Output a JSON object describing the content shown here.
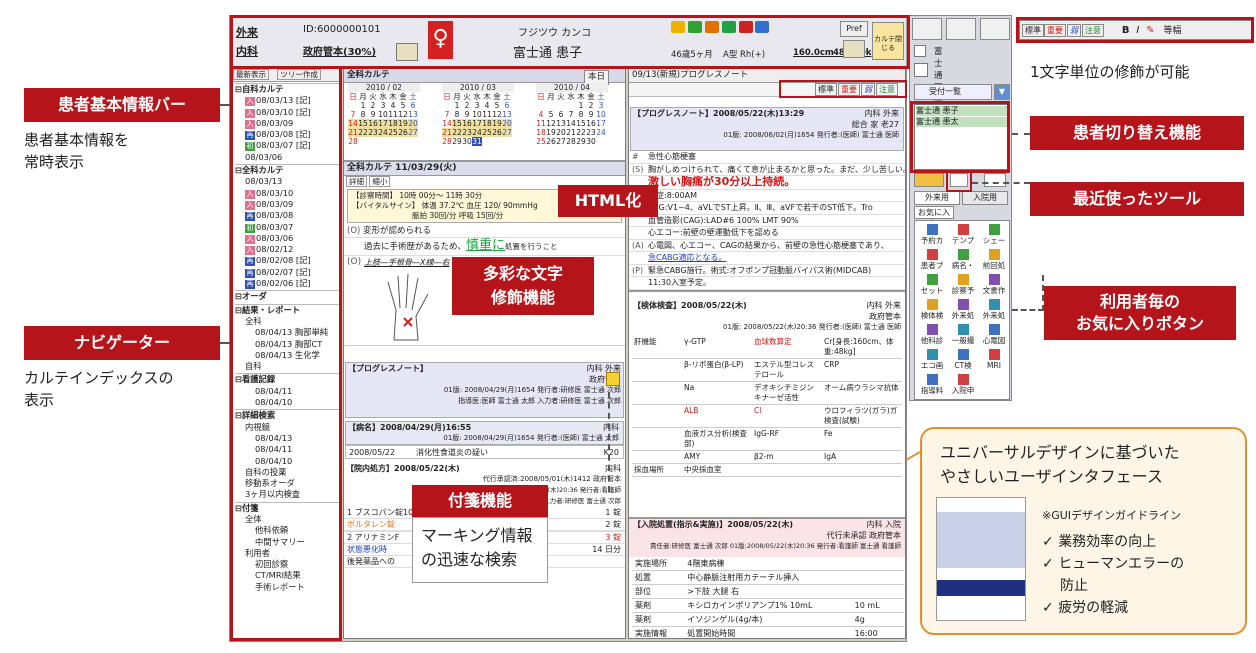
{
  "labels": {
    "patient_bar": "患者基本情報バー",
    "patient_bar_desc1": "患者基本情報を",
    "patient_bar_desc2": "常時表示",
    "navigator": "ナビゲーター",
    "navigator_desc1": "カルテインデックスの",
    "navigator_desc2": "表示",
    "html": "HTML化",
    "text_deco1": "多彩な文字",
    "text_deco2": "修飾機能",
    "sticky": "付箋機能",
    "sticky_desc1": "マーキング情報",
    "sticky_desc2": "の迅速な検索",
    "char_unit": "1文字単位の修飾が可能",
    "patient_switch": "患者切り替え機能",
    "recent_tool": "最近使ったツール",
    "favorites1": "利用者毎の",
    "favorites2": "お気に入りボタン",
    "ud_title1": "ユニバーサルデザインに基づいた",
    "ud_title2": "やさしいユーザインタフェース",
    "ud_guide": "※GUIデザインガイドライン",
    "ud_points": [
      "業務効率の向上",
      "ヒューマンエラーの",
      "防止",
      "疲労の軽減"
    ]
  },
  "patient": {
    "dept": "外来",
    "ward": "内科",
    "id": "ID:6000000101",
    "doctor": "政府管本(30%)",
    "kana": "フジツウ カンコ",
    "name": "富士通 患子",
    "age": "46歳5ヶ月",
    "blood": "A型 Rh(+)",
    "height": "160.0cm",
    "weight": "48.000kg",
    "pref": "Pref",
    "close": "カルテ閉じる"
  },
  "toolbar_right": {
    "deco": [
      "標準",
      "重要",
      "弱",
      "注意",
      "B",
      "I",
      "等幅"
    ],
    "user": "富士通 医師",
    "reception": "受付一覧"
  },
  "nav": {
    "btn1": "最新表示",
    "btn2": "ツリー作成",
    "items": [
      {
        "t": "自科カルテ",
        "c": "hd"
      },
      {
        "t": "08/03/13 [記]",
        "c": "in1",
        "m": "入",
        "mc": "#e07090"
      },
      {
        "t": "08/03/10 [記]",
        "c": "in1",
        "m": "入",
        "mc": "#e07090"
      },
      {
        "t": "08/03/09",
        "c": "in1",
        "m": "入",
        "mc": "#e07090"
      },
      {
        "t": "08/03/08 [記]",
        "c": "in1",
        "m": "再",
        "mc": "#3050b0"
      },
      {
        "t": "08/03/07 [記]",
        "c": "in1",
        "m": "初",
        "mc": "#40a040"
      },
      {
        "t": "08/03/06",
        "c": "in1",
        "m": "",
        "mc": ""
      },
      {
        "t": "全科カルテ",
        "c": "hd"
      },
      {
        "t": "08/03/13",
        "c": "in1",
        "m": "",
        "mc": ""
      },
      {
        "t": "08/03/10",
        "c": "in1",
        "m": "入",
        "mc": "#e07090"
      },
      {
        "t": "08/03/09",
        "c": "in1",
        "m": "入",
        "mc": "#e07090"
      },
      {
        "t": "08/03/08",
        "c": "in1",
        "m": "再",
        "mc": "#3050b0"
      },
      {
        "t": "08/03/07",
        "c": "in1",
        "m": "初",
        "mc": "#40a040"
      },
      {
        "t": "08/03/06",
        "c": "in1",
        "m": "入",
        "mc": "#e07090"
      },
      {
        "t": "08/02/12",
        "c": "in1",
        "m": "入",
        "mc": "#e07090"
      },
      {
        "t": "08/02/08 [記]",
        "c": "in1",
        "m": "再",
        "mc": "#3050b0"
      },
      {
        "t": "08/02/07 [記]",
        "c": "in1",
        "m": "再",
        "mc": "#3050b0"
      },
      {
        "t": "08/02/06 [記]",
        "c": "in1",
        "m": "再",
        "mc": "#3050b0"
      },
      {
        "t": "オーダ",
        "c": "hd"
      },
      {
        "t": "結果・レポート",
        "c": "hd"
      },
      {
        "t": "全科",
        "c": "in1",
        "m": "",
        "mc": ""
      },
      {
        "t": "08/04/13 胸部単純",
        "c": "in2",
        "m": "",
        "mc": ""
      },
      {
        "t": "08/04/13 胸部CT",
        "c": "in2",
        "m": "",
        "mc": ""
      },
      {
        "t": "08/04/13 生化学",
        "c": "in2",
        "m": "",
        "mc": ""
      },
      {
        "t": "自科",
        "c": "in1",
        "m": "",
        "mc": ""
      },
      {
        "t": "看護記録",
        "c": "hd"
      },
      {
        "t": "08/04/11",
        "c": "in2",
        "m": "",
        "mc": ""
      },
      {
        "t": "08/04/10",
        "c": "in2",
        "m": "",
        "mc": ""
      },
      {
        "t": "詳細検索",
        "c": "hd"
      },
      {
        "t": "内視鏡",
        "c": "in1",
        "m": "",
        "mc": ""
      },
      {
        "t": "08/04/13",
        "c": "in2",
        "m": "",
        "mc": ""
      },
      {
        "t": "08/04/11",
        "c": "in2",
        "m": "",
        "mc": ""
      },
      {
        "t": "08/04/10",
        "c": "in2",
        "m": "",
        "mc": ""
      },
      {
        "t": "自科の投薬",
        "c": "in1",
        "m": "",
        "mc": ""
      },
      {
        "t": "移動系オーダ",
        "c": "in1",
        "m": "",
        "mc": ""
      },
      {
        "t": "3ヶ月以内検査",
        "c": "in1",
        "m": "",
        "mc": ""
      },
      {
        "t": "付箋",
        "c": "hd"
      },
      {
        "t": "全体",
        "c": "in1",
        "m": "",
        "mc": ""
      },
      {
        "t": "他科依頼",
        "c": "in2",
        "m": "",
        "mc": ""
      },
      {
        "t": "中間サマリー",
        "c": "in2",
        "m": "",
        "mc": ""
      },
      {
        "t": "利用者",
        "c": "in1",
        "m": "",
        "mc": ""
      },
      {
        "t": "初回診察",
        "c": "in2",
        "m": "",
        "mc": ""
      },
      {
        "t": "CT/MRI結果",
        "c": "in2",
        "m": "",
        "mc": ""
      },
      {
        "t": "手術レポート",
        "c": "in2",
        "m": "",
        "mc": ""
      }
    ]
  },
  "karte": {
    "title": "全科カルテ",
    "today": "本日",
    "months": [
      "2010 / 02",
      "2010 / 03",
      "2010 / 04"
    ],
    "dow": [
      "日",
      "月",
      "火",
      "水",
      "木",
      "金",
      "土"
    ],
    "entry_title": "全科カルテ 11/03/29(火)",
    "detail": "詳細",
    "shrink": "縮小",
    "vitals1": "【診察時間】 10時 00分～ 11時 30分",
    "vitals2": "【バイタルサイン】 体温 37.2℃  血圧 120/ 90mmHg",
    "vitals3": "脈拍 30回/分  呼吸 15回/分",
    "o1": "変形が認められる",
    "o2a": "過去に手術歴があるため、",
    "o2b": "慎重に",
    "o2c": "処置を行うこと",
    "o3": "上肢―手根骨―X線―右",
    "prog_title": "【プログレスノート】",
    "prog_dept": "内科 外来",
    "prog_doc": "政府管本",
    "prog_ver": "01版: 2008/04/29(月)1654 発行者:研修医 富士通 次郎",
    "prog_ver2": "指導医:医師 富士通 太郎 入力者:研修医 富士通 次郎",
    "disease_h": "【病名】2008/04/29(月)16:55",
    "disease_dept": "内科",
    "disease_ver": "01版: 2008/04/29(月)1654 発行者:(医師) 富士通 太郎",
    "disease_row": [
      "2008/05/22",
      "消化性食道炎の疑い",
      "K20"
    ],
    "rx_h": "【院内処方】2008/05/22(木)",
    "rx_dept": "内科",
    "rx_l1": "代行承認済:2008/05/01(木)1412 政府管本",
    "rx_l2": "責任者:研修医 富士通 次郎 01版:2008/05/22(木)20:36 発行者:看護師",
    "rx_l3": "指導医:医師 富士通 太郎 入力者:研修医 富士通 次郎",
    "rx_items": [
      [
        "1 ブスコパン錠10mg",
        "1 錠"
      ],
      [
        "ボルタレン錠",
        "2 錠"
      ],
      [
        "",
        "2 日分"
      ],
      [
        "2 アリナミンF",
        "3 錠"
      ],
      [
        "状態悪化時",
        "14 日分"
      ],
      [
        "後発薬品への",
        ""
      ]
    ]
  },
  "progress": {
    "title": "09/13(新規)プログレスノート",
    "deco": [
      "標準",
      "重要",
      "弱",
      "注意"
    ],
    "h": "【プログレスノート】2008/05/22(木)13:29",
    "dept": "内科 外来",
    "l1": "総合 家 老27",
    "l2": "01版: 2008/06/02(月)1654 発行者:(医師) 富士通 医師",
    "rows": [
      {
        "k": "#",
        "t": "急性心筋梗塞",
        "c": ""
      },
      {
        "k": "(S)",
        "t": "胸がしめつけられて、痛くて息が止まるかと思った。まだ、少し苦しい。",
        "c": ""
      },
      {
        "k": "",
        "t": "激しい胸痛が30分以上持続。",
        "c": "red"
      },
      {
        "k": "(O)",
        "t": "発症:8:00AM",
        "c": ""
      },
      {
        "k": "",
        "t": "ECG:V1~4、aVLでST上昇。Ⅱ、Ⅲ、aVFで若干のST低下。Tro",
        "c": ""
      },
      {
        "k": "",
        "t": "血管造影(CAG):LAD#6 100% LMT 90%",
        "c": ""
      },
      {
        "k": "",
        "t": "心エコー:前壁の壁運動低下を認める",
        "c": ""
      },
      {
        "k": "(A)",
        "t": "心電図、心エコー、CAGの結果から、前壁の急性心筋梗塞であり、",
        "c": ""
      },
      {
        "k": "",
        "t": "急CABG適応となる。",
        "c": "blue"
      },
      {
        "k": "(P)",
        "t": "緊急CABG施行。術式:オフポンプ冠動脈バイパス術(MIDCAB)",
        "c": ""
      },
      {
        "k": "",
        "t": "11:30入室予定。",
        "c": ""
      }
    ],
    "lab_h": "【検体検査】2008/05/22(木)",
    "lab_dept": "内科 外来",
    "lab_doc": "政府管本",
    "lab_ver": "01版: 2008/05/22(木)20:36 発行者:(医師) 富士通 医師",
    "lab_rows": [
      [
        "肝機能",
        "γ-GTP",
        "血球数算定",
        "Cr[身長:160cm、体重:48kg]"
      ],
      [
        "",
        "β-リポ蛋白(β-LP)",
        "エステル型コレステロール",
        "CRP"
      ],
      [
        "",
        "Na",
        "デオキシチミジンキナーゼ活性",
        "オーム病ウラシマ抗体"
      ],
      [
        "",
        "ALB",
        "Cl",
        "ウロフィラツ(ガラ)ガ 検査(試験)"
      ],
      [
        "",
        "血液ガス分析(検査部)",
        "IgG-RF",
        "Fe"
      ],
      [
        "",
        "AMY",
        "β2-m",
        "IgA"
      ],
      [
        "採血場所",
        "中央採血室",
        "",
        ""
      ]
    ],
    "inj_h": "【入院処置(指示&実施)】2008/05/22(木)",
    "inj_dept": "内科 入院",
    "inj_l1": "代行未承認 政府管本",
    "inj_l2": "責任者:研修医 富士通 次郎 01版:2008/05/22(木)20:36 発行者:看護師 富士通 看護師",
    "inj_rows": [
      [
        "実施場所",
        "4階東病棟",
        ""
      ],
      [
        "処置",
        "中心静脈注射用カテーテル挿入",
        ""
      ],
      [
        "部位",
        ">下肢 大腿 右",
        ""
      ],
      [
        "薬剤",
        "キシロカインポリアンプ1% 10mL",
        "10 mL"
      ],
      [
        "薬剤",
        "イソジンゲル(4g/本)",
        "4g"
      ],
      [
        "実施情報",
        "処置開始時間",
        "16:00"
      ]
    ]
  },
  "right": {
    "patients": [
      "富士通 患子",
      "富士通 患太"
    ],
    "tabs": [
      "外来用",
      "入院用"
    ],
    "fav": "お気に入り",
    "tools": [
      [
        "予約カ",
        "テンプ",
        "シェー"
      ],
      [
        "患者プ",
        "病名・",
        "前回処"
      ],
      [
        "セット",
        "診察予",
        "文書作"
      ],
      [
        "検体検",
        "外来処",
        "外来処"
      ],
      [
        "他科診",
        "一般撮",
        "心電図"
      ],
      [
        "エコ画",
        "CT検",
        "MRI"
      ],
      [
        "指導料",
        "入院申",
        ""
      ]
    ]
  }
}
